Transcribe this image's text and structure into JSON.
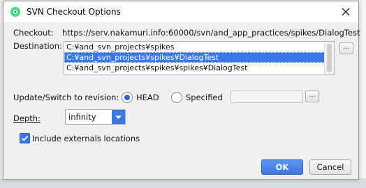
{
  "dialog": {
    "title": "SVN Checkout Options",
    "checkout_label": "Checkout:",
    "checkout_url": "https://serv.nakamuri.info:60000/svn/and_app_practices/spikes/DialogTest",
    "destination_label": "Destination:",
    "destinations": [
      {
        "path": "C:¥and_svn_projects¥spikes",
        "selected": false
      },
      {
        "path": "C:¥and_svn_projects¥spikes¥DialogTest",
        "selected": true
      },
      {
        "path": "C:¥and_svn_projects¥spikes¥spikes¥DialogTest",
        "selected": false
      }
    ],
    "browse_label": "...",
    "revision_label": "Update/Switch to revision:",
    "head_label": "HEAD",
    "specified_label": "Specified",
    "revision_value": "",
    "revision_mode": "HEAD",
    "depth_label": "Depth:",
    "depth_value": "infinity",
    "externals_label": "Include externals locations",
    "externals_checked": true,
    "ok_label": "OK",
    "cancel_label": "Cancel"
  },
  "colors": {
    "accent": "#3b78e7",
    "dialog_bg": "#f0f0f0"
  },
  "icons": {
    "app": "android-studio-icon",
    "close": "close-icon",
    "dropdown": "chevron-down-icon",
    "check": "checkmark-icon"
  }
}
